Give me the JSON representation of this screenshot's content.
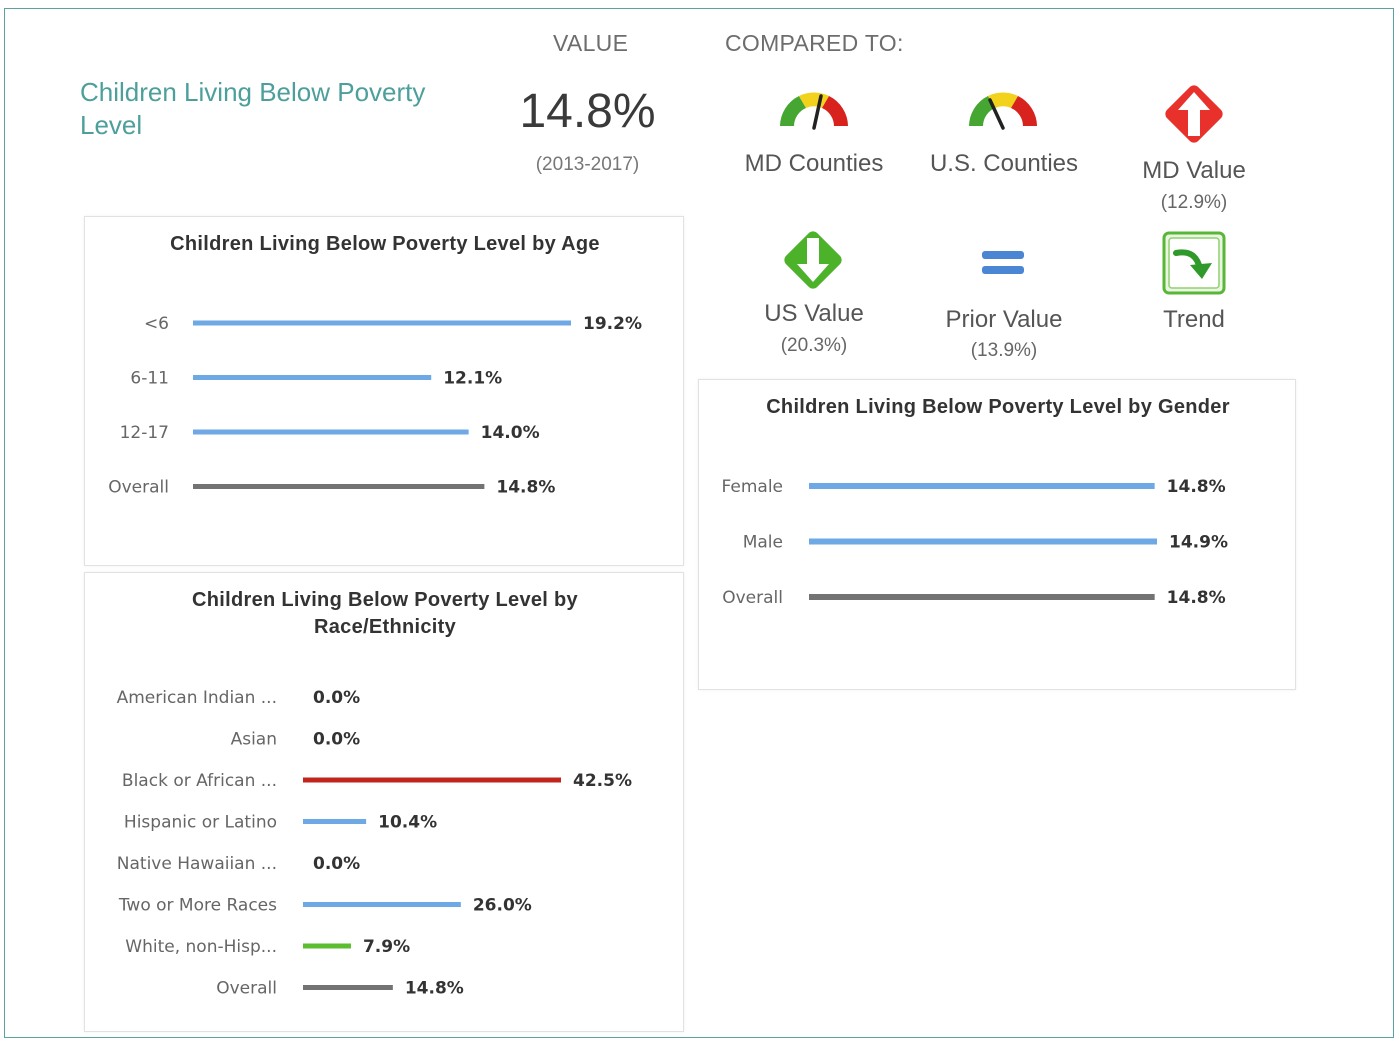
{
  "indicator": {
    "title": "Children Living Below Poverty Level",
    "value_header": "VALUE",
    "compared_header": "COMPARED TO:",
    "value": "14.8%",
    "period": "(2013-2017)"
  },
  "comparisons": [
    {
      "label": "MD Counties",
      "sub": "",
      "icon": "gauge-icon"
    },
    {
      "label": "U.S. Counties",
      "sub": "",
      "icon": "gauge-icon"
    },
    {
      "label": "MD Value",
      "sub": "(12.9%)",
      "icon": "red-arrow-up-icon"
    },
    {
      "label": "US Value",
      "sub": "(20.3%)",
      "icon": "green-arrow-down-icon"
    },
    {
      "label": "Prior Value",
      "sub": "(13.9%)",
      "icon": "equals-icon"
    },
    {
      "label": "Trend",
      "sub": "",
      "icon": "trend-arrow-icon"
    }
  ],
  "colors": {
    "accent_teal": "#4d9f9b",
    "bar_blue": "#6ea9e6",
    "bar_gray": "#737373",
    "bar_red": "#c0241c",
    "bar_green": "#5bbd2f",
    "gauge_green": "#46a632",
    "gauge_yellow": "#f2d21a",
    "gauge_red": "#d7221e"
  },
  "chart_data": [
    {
      "type": "bar",
      "orientation": "horizontal",
      "title": "Children Living Below Poverty Level by Age",
      "categories": [
        "<6",
        "6-11",
        "12-17",
        "Overall"
      ],
      "values": [
        19.2,
        12.1,
        14.0,
        14.8
      ],
      "labels": [
        "19.2%",
        "12.1%",
        "14.0%",
        "14.8%"
      ],
      "colors": [
        "#6ea9e6",
        "#6ea9e6",
        "#6ea9e6",
        "#737373"
      ],
      "xlim": [
        0,
        19.2
      ]
    },
    {
      "type": "bar",
      "orientation": "horizontal",
      "title": "Children Living Below Poverty Level by Gender",
      "categories": [
        "Female",
        "Male",
        "Overall"
      ],
      "values": [
        14.8,
        14.9,
        14.8
      ],
      "labels": [
        "14.8%",
        "14.9%",
        "14.8%"
      ],
      "colors": [
        "#6ea9e6",
        "#6ea9e6",
        "#737373"
      ],
      "xlim": [
        0,
        14.9
      ]
    },
    {
      "type": "bar",
      "orientation": "horizontal",
      "title": "Children Living Below Poverty Level by Race/Ethnicity",
      "categories": [
        "American Indian ...",
        "Asian",
        "Black or African ...",
        "Hispanic or Latino",
        "Native Hawaiian ...",
        "Two or More Races",
        "White, non-Hisp...",
        "Overall"
      ],
      "values": [
        0.0,
        0.0,
        42.5,
        10.4,
        0.0,
        26.0,
        7.9,
        14.8
      ],
      "labels": [
        "0.0%",
        "0.0%",
        "42.5%",
        "10.4%",
        "0.0%",
        "26.0%",
        "7.9%",
        "14.8%"
      ],
      "colors": [
        "#6ea9e6",
        "#6ea9e6",
        "#c0241c",
        "#6ea9e6",
        "#6ea9e6",
        "#6ea9e6",
        "#5bbd2f",
        "#737373"
      ],
      "xlim": [
        0,
        42.5
      ]
    }
  ]
}
